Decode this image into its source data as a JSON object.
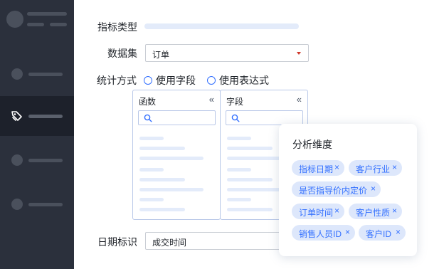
{
  "form": {
    "metric_type_label": "指标类型",
    "dataset_label": "数据集",
    "dataset_value": "订单",
    "stat_method_label": "统计方式",
    "radio_field": "使用字段",
    "radio_expression": "使用表达式",
    "date_label": "日期标识",
    "date_value": "成交时间"
  },
  "panels": {
    "function_title": "函数",
    "field_title": "字段",
    "collapse_glyph": "«"
  },
  "dimension_card": {
    "title": "分析维度",
    "chips": [
      "指标日期",
      "客户行业",
      "是否指导价内定价",
      "订单时间",
      "客户性质",
      "销售人员ID",
      "客户ID"
    ],
    "remove_glyph": "×"
  },
  "colors": {
    "sidebar_bg": "#2b303c",
    "sidebar_active_bg": "#1d212b",
    "accent": "#3370ff",
    "chip_bg": "#dde7fb"
  },
  "icons": {
    "active_nav": "tag-icon",
    "search": "search-icon",
    "caret": "caret-down-icon"
  }
}
